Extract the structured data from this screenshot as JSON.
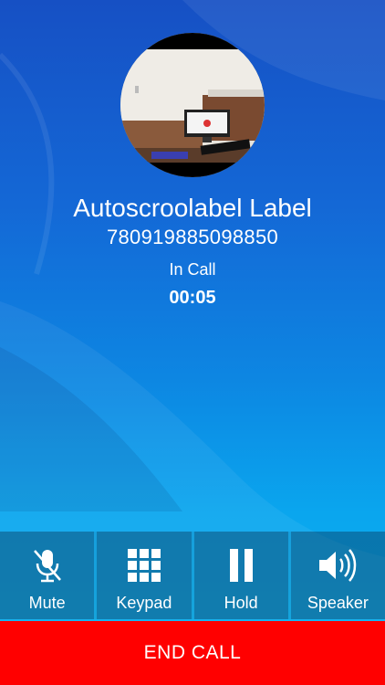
{
  "caller": {
    "name": "Autoscroolabel Label",
    "number": "780919885098850"
  },
  "call": {
    "status": "In Call",
    "timer": "00:05"
  },
  "controls": {
    "mute": {
      "label": "Mute",
      "icon": "mic-off-icon"
    },
    "keypad": {
      "label": "Keypad",
      "icon": "dialpad-icon"
    },
    "hold": {
      "label": "Hold",
      "icon": "pause-icon"
    },
    "speaker": {
      "label": "Speaker",
      "icon": "speaker-icon"
    }
  },
  "end_call": {
    "label": "END CALL"
  },
  "colors": {
    "end_call_bg": "#ff0000",
    "background_top": "#1650c4",
    "background_bottom": "#08b4f0"
  }
}
